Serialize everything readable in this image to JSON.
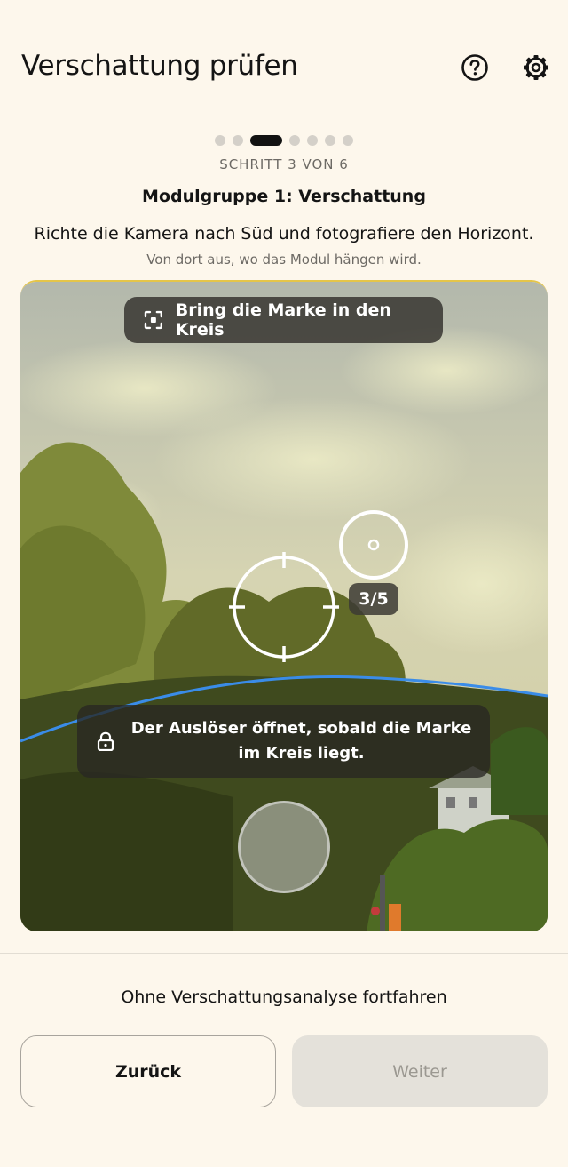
{
  "header": {
    "title": "Verschattung prüfen"
  },
  "progress": {
    "current_step": 3,
    "total_steps": 7,
    "step_label": "SCHRITT 3 VON 6"
  },
  "content": {
    "group_title": "Modulgruppe 1: Verschattung",
    "instruction": "Richte die Kamera nach Süd und fotografiere den Horizont.",
    "sub_instruction": "Von dort aus, wo das Modul hängen wird."
  },
  "camera": {
    "hint": "Bring die Marke in den Kreis",
    "counter": "3/5",
    "shutter_info": "Der Auslöser öffnet, sobald die Marke im Kreis liegt.",
    "horizon_color": "#3a8ce8"
  },
  "footer": {
    "skip_label": "Ohne Verschattungsanalyse fortfahren",
    "back_label": "Zurück",
    "next_label": "Weiter"
  }
}
